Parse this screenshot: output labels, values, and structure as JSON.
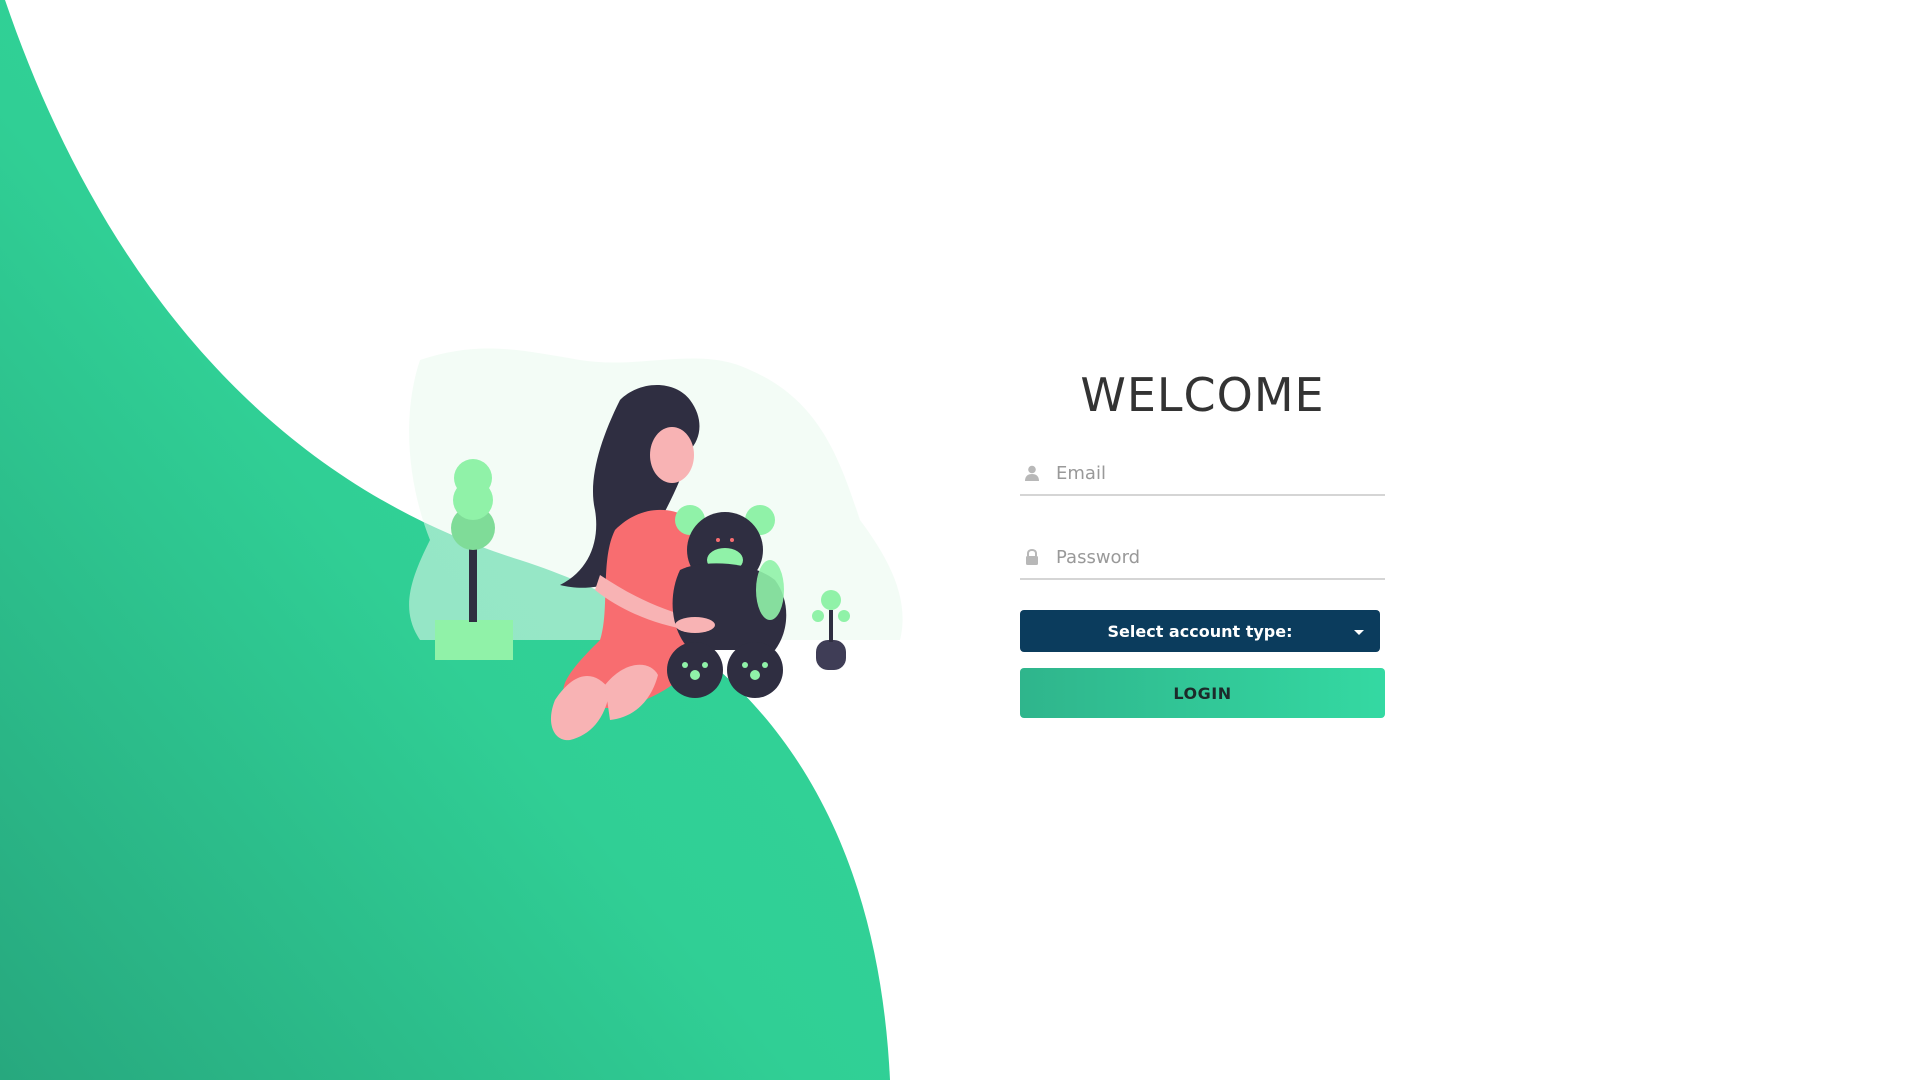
{
  "colors": {
    "accent_green": "#2fd095",
    "dark_navy": "#0b3c5d",
    "title_text": "#333333",
    "illustration_dark": "#2f2e41",
    "illustration_coral": "#f86d70",
    "illustration_light_green": "#90f2a8"
  },
  "illustration": {
    "description_icon": "girl-with-teddy-bear-illustration"
  },
  "login": {
    "title": "WELCOME",
    "email": {
      "placeholder": "Email",
      "icon": "user-icon"
    },
    "password": {
      "placeholder": "Password",
      "icon": "lock-icon"
    },
    "account_type": {
      "label": "Select account type:",
      "icon": "caret-down-icon"
    },
    "login_button": "LOGIN"
  }
}
